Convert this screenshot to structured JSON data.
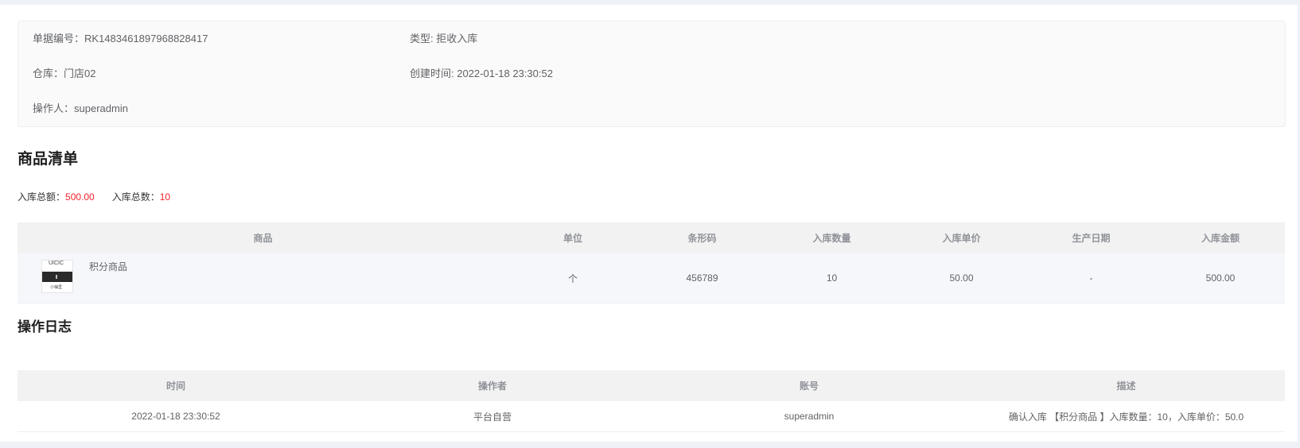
{
  "order_info": {
    "order_no_label": "单据编号：",
    "order_no": "RK1483461897968828417",
    "type_label": "类型: ",
    "type": "拒收入库",
    "warehouse_label": "仓库：",
    "warehouse": "门店02",
    "created_label": "创建时间: ",
    "created": "2022-01-18 23:30:52",
    "operator_label": "操作人：",
    "operator": "superadmin"
  },
  "goods_section": {
    "title": "商品清单",
    "total_amount_label": "入库总额：",
    "total_amount": "500.00",
    "total_qty_label": "入库总数：",
    "total_qty": "10",
    "headers": [
      "商品",
      "单位",
      "条形码",
      "入库数量",
      "入库单价",
      "生产日期",
      "入库金额"
    ],
    "rows": [
      {
        "thumb_top_text": "UICIC",
        "thumb_bottom_text": "小柚里",
        "name": "积分商品",
        "unit": "个",
        "barcode": "456789",
        "qty": "10",
        "unit_price": "50.00",
        "production_date": "-",
        "amount": "500.00"
      }
    ]
  },
  "log_section": {
    "title": "操作日志",
    "headers": [
      "时间",
      "操作者",
      "账号",
      "描述"
    ],
    "rows": [
      {
        "time": "2022-01-18 23:30:52",
        "operator": "平台自营",
        "account": "superadmin",
        "description": "确认入库 【积分商品 】入库数量：10，入库单价：50.0"
      }
    ]
  }
}
